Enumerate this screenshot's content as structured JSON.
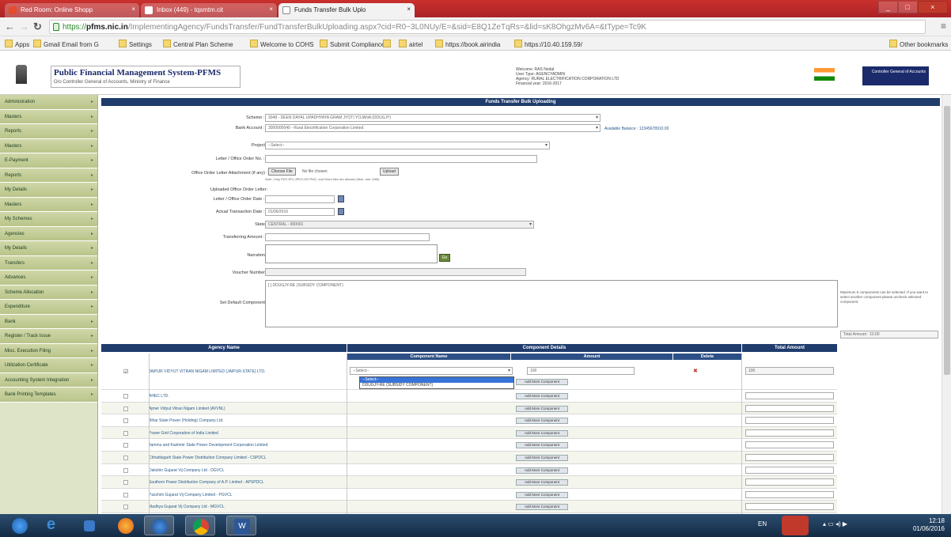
{
  "browser": {
    "tabs": [
      {
        "label": "Red Room: Online Shopp",
        "color": "#e34d2c"
      },
      {
        "label": "Inbox (449) - tqsmtm.cit",
        "color": "#d93025"
      },
      {
        "label": "Funds Transfer Bulk Uplo",
        "color": "#f2f2f2"
      }
    ],
    "close_glyph": "×",
    "window_buttons": [
      "_",
      "□",
      "×"
    ],
    "url_scheme": "https://",
    "url_host": "pfms.nic.in",
    "url_path": "/ImplementingAgency/FundsTransfer/FundTransferBulkUploading.aspx?cid=R0~3L0NUy/E=&sid=E8Q1ZeTqRs=&lid=sK8OhgzMv6A=&tType=Tc9K",
    "nav_icons": [
      "back-arrow-icon",
      "forward-arrow-icon",
      "reload-icon"
    ],
    "bookmarks": [
      "Apps",
      "Gmail Email from G",
      "Settings",
      "Central Plan Scheme",
      "Welcome to COHS",
      "Submit Compliance",
      "",
      "airtel",
      "https://book.airindia",
      "https://10.40.159.59/"
    ],
    "other_bookmarks": "Other bookmarks"
  },
  "site": {
    "title": "Public Financial Management System-PFMS",
    "subtitle": "O/o Controller General of Accounts, Ministry of Finance",
    "user_info": [
      "Welcome: RAS Nodal",
      "User Type: AGENCYADMIN",
      "Agency: RURAL ELECTRIFICATION CORPORATION LTD",
      "Financial year: 2016-2017"
    ],
    "gov_logo_text": "Controller General of Accounts"
  },
  "sidebar": {
    "items": [
      "Administration",
      "Masters",
      "Reports",
      "Masters",
      "E-Payment",
      "Reports",
      "My Details",
      "Masters",
      "My Schemes",
      "Agencies",
      "My Details",
      "Transfers",
      "Advances",
      "Scheme Allocation",
      "Expenditure",
      "Bank",
      "Register / Track Issue",
      "Misc. Execution Filing",
      "Utilization Certificate",
      "Accounting System Integration",
      "Bank Printing Templates"
    ]
  },
  "form": {
    "page_title": "Funds Transfer Bulk Uploading",
    "scheme_label": "Scheme : *",
    "scheme_value": "3048 - DEEN DAYAL UPADHYAYA GRAM JYOTI YOJANA (DDUGJY)",
    "bank_label": "Bank Account : *",
    "bank_value": "3000000040 - Rural Electrification Corporation Limited",
    "bank_note": "Available Balance : 12345678910.00",
    "project_label": "Project :",
    "project_value": "--Select--",
    "letter_no_label": "Letter / Office Order No. : *",
    "attach_label": "Office Order Letter Attachment (if any) :",
    "choose_file": "Choose File",
    "no_file": "No file chosen",
    "upload_btn": "Upload",
    "attach_note": "Note: Only PDF,JPG,JPEG,GIF,PNG, and Word files are allowed (Max. size 1MB)",
    "uploaded_label": "Uploaded Office Order Letter:",
    "letter_date_label": "Letter / Office Order Date : *",
    "txn_date_label": "Actual Transaction Date : *",
    "txn_date_value": "01/06/2016",
    "state_label": "State :",
    "state_value": "CENTRAL - 000001",
    "amount_label": "Transferring Amount : *",
    "narration_label": "Narration :",
    "go_btn": "Go",
    "voucher_label": "Voucher Number :",
    "component_label": "Set Default Component :",
    "component_value": "[ ] DDUGJY-RE (SUBSIDY COMPONENT)",
    "component_note": "Maximum 5 components can be selected. If you want to select another component please uncheck selected component.",
    "total_amount": "Total Amount : 10.00"
  },
  "table": {
    "headers": [
      "Agency Name",
      "Component Details",
      "Total Amount"
    ],
    "subheaders": [
      "Component Name",
      "Amount",
      "Delete"
    ],
    "first_row": {
      "checkbox": "☑",
      "agency": "JAIPUR VIDYUT VITRAN NIGAM LIMITED (JAIPUR-STATE) LTD.",
      "component": "--Select--",
      "amount": "100",
      "delete": "✖",
      "total": "100",
      "add_btn": "Add More Component"
    },
    "dropdown": [
      "--Select--",
      "DDUGJY-RE (SUBSIDY COMPONENT)"
    ],
    "rows": [
      "AHEC LTD.",
      "Ajmer Vidyut Vitran Nigam Limited (AVVNL)",
      "Bihar State Power (Holding) Company Ltd.",
      "Power Grid Corporation of India Limited",
      "Jammu and Kashmir State Power Development Corporation Limited",
      "Chhattisgarh State Power Distribution Company Limited - CSPDCL",
      "Dakshin Gujarat Vij Company Ltd - DGVCL",
      "Southern Power Distribution Company of A.P. Limited - APSPDCL",
      "Paschim Gujarat Vij Company Limited - PGVCL",
      "Madhya Gujarat Vij Company Ltd - MGVCL"
    ],
    "row_btn": "Add More Component"
  },
  "taskbar": {
    "apps": [
      "start-orb",
      "ie-icon",
      "explorer-icon",
      "firefox-icon",
      "chrome-icon",
      "word-icon"
    ],
    "lang": "EN",
    "time": "12:18",
    "date": "01/06/2016"
  }
}
